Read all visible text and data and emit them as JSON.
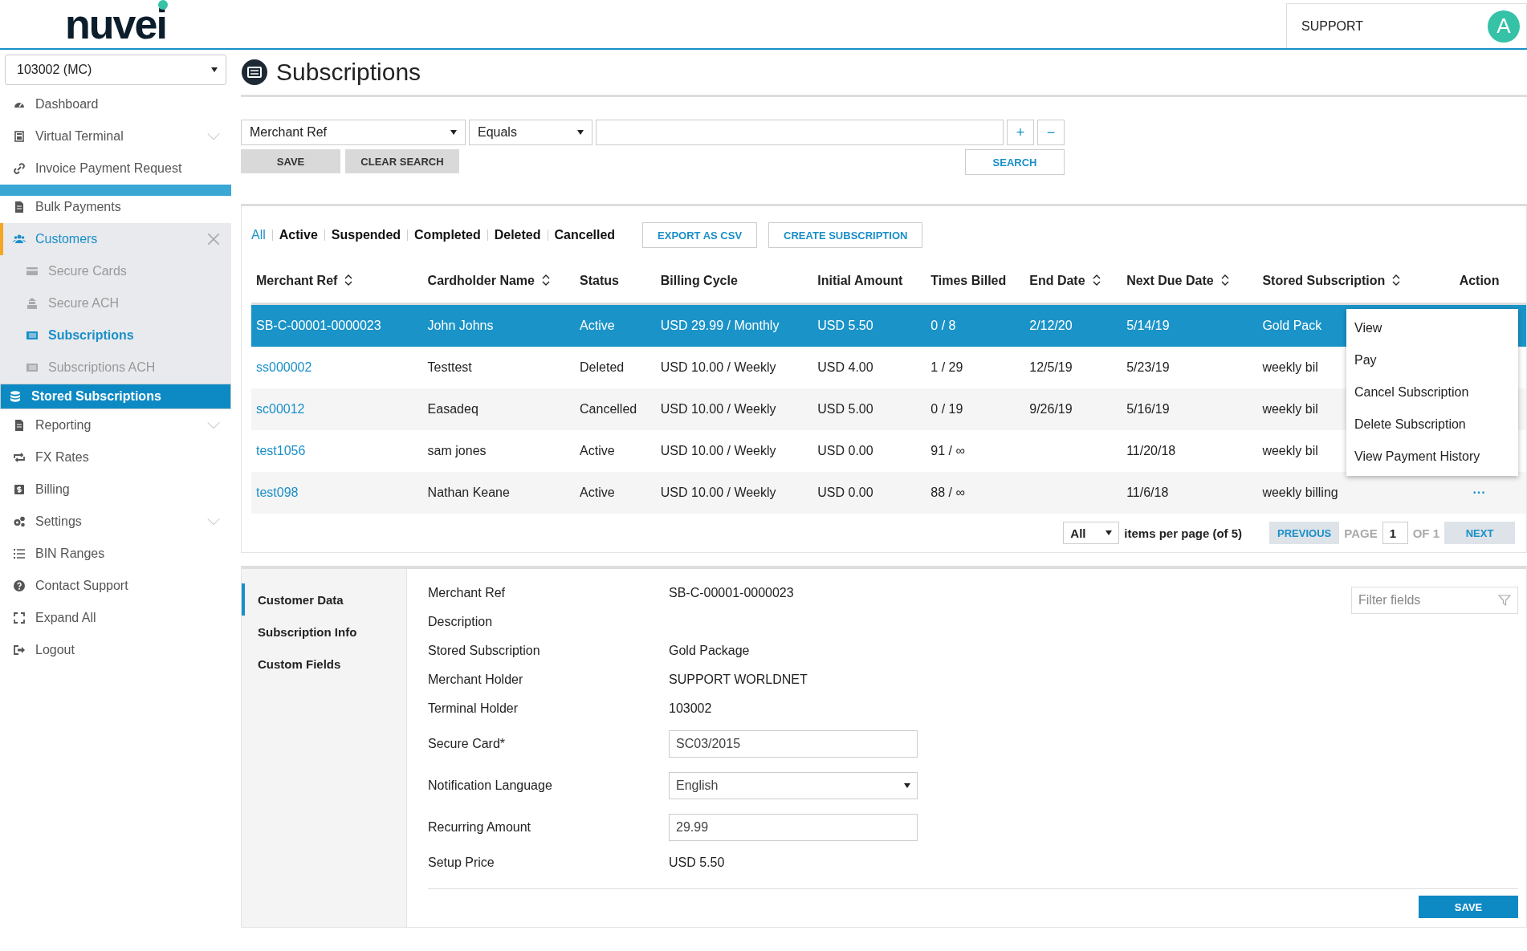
{
  "header": {
    "logo": "nuvei",
    "support": "SUPPORT",
    "avatar": "A"
  },
  "sidebar": {
    "account": "103002 (MC)",
    "items": [
      {
        "label": "Dashboard",
        "expandable": false
      },
      {
        "label": "Virtual Terminal",
        "expandable": true
      },
      {
        "label": "Invoice Payment Request",
        "expandable": false
      },
      {
        "label": "Bulk Payments",
        "expandable": false
      },
      {
        "label": "Customers",
        "expanded": true,
        "children": [
          {
            "label": "Secure Cards",
            "selected": false,
            "disabled": true
          },
          {
            "label": "Secure ACH",
            "selected": false,
            "disabled": true
          },
          {
            "label": "Subscriptions",
            "selected": false,
            "disabled": false
          },
          {
            "label": "Subscriptions ACH",
            "selected": false,
            "disabled": true
          },
          {
            "label": "Stored Subscriptions",
            "selected": true,
            "disabled": false
          }
        ]
      },
      {
        "label": "Reporting",
        "expandable": true
      },
      {
        "label": "FX Rates",
        "expandable": false
      },
      {
        "label": "Billing",
        "expandable": false
      },
      {
        "label": "Settings",
        "expandable": true
      },
      {
        "label": "BIN Ranges",
        "expandable": false
      },
      {
        "label": "Contact Support",
        "expandable": false
      },
      {
        "label": "Expand All",
        "expandable": false
      },
      {
        "label": "Logout",
        "expandable": false
      }
    ]
  },
  "page": {
    "title": "Subscriptions"
  },
  "search": {
    "field": "Merchant Ref",
    "operator": "Equals",
    "add": "+",
    "remove": "−",
    "save": "SAVE",
    "clear": "CLEAR SEARCH",
    "search": "SEARCH"
  },
  "status_filters": [
    {
      "label": "All",
      "selected": true
    },
    {
      "label": "Active",
      "selected": false
    },
    {
      "label": "Suspended",
      "selected": false
    },
    {
      "label": "Completed",
      "selected": false
    },
    {
      "label": "Deleted",
      "selected": false
    },
    {
      "label": "Cancelled",
      "selected": false
    }
  ],
  "actions": [
    "EXPORT AS CSV",
    "CREATE SUBSCRIPTION"
  ],
  "table": {
    "columns": [
      {
        "label": "Merchant Ref",
        "sortable": true
      },
      {
        "label": "Cardholder Name",
        "sortable": true
      },
      {
        "label": "Status",
        "sortable": false
      },
      {
        "label": "Billing Cycle",
        "sortable": false
      },
      {
        "label": "Initial Amount",
        "sortable": false
      },
      {
        "label": "Times Billed",
        "sortable": false
      },
      {
        "label": "End Date",
        "sortable": true
      },
      {
        "label": "Next Due Date",
        "sortable": true
      },
      {
        "label": "Stored Subscription",
        "sortable": true
      },
      {
        "label": "Action",
        "sortable": false
      }
    ],
    "rows": [
      {
        "selected": true,
        "cells": [
          "SB-C-00001-0000023",
          "John Johns",
          "Active",
          "USD 29.99 / Monthly",
          "USD 5.50",
          "0 / 8",
          "2/12/20",
          "5/14/19",
          "Gold Pack"
        ]
      },
      {
        "selected": false,
        "cells": [
          "ss000002",
          "Testtest",
          "Deleted",
          "USD 10.00 / Weekly",
          "USD 4.00",
          "1 / 29",
          "12/5/19",
          "5/23/19",
          "weekly bil"
        ]
      },
      {
        "selected": false,
        "cells": [
          "sc00012",
          "Easadeq",
          "Cancelled",
          "USD 10.00 / Weekly",
          "USD 5.00",
          "0 / 19",
          "9/26/19",
          "5/16/19",
          "weekly bil"
        ]
      },
      {
        "selected": false,
        "cells": [
          "test1056",
          "sam jones",
          "Active",
          "USD 10.00 / Weekly",
          "USD 0.00",
          "91 / ∞",
          "",
          "11/20/18",
          "weekly bil"
        ]
      },
      {
        "selected": false,
        "cells": [
          "test098",
          "Nathan Keane",
          "Active",
          "USD 10.00 / Weekly",
          "USD 0.00",
          "88 / ∞",
          "",
          "11/6/18",
          "weekly billing"
        ],
        "action": "···"
      }
    ]
  },
  "action_menu": [
    "View",
    "Pay",
    "Cancel Subscription",
    "Delete Subscription",
    "View Payment History"
  ],
  "pagination": {
    "per_page": "All",
    "per_page_label": "items per page (of 5)",
    "previous": "PREVIOUS",
    "page_label": "PAGE",
    "page": "1",
    "of": "OF 1",
    "next": "NEXT"
  },
  "details": {
    "tabs": [
      {
        "label": "Customer Data",
        "selected": true
      },
      {
        "label": "Subscription Info",
        "selected": false
      },
      {
        "label": "Custom Fields",
        "selected": false
      }
    ],
    "filter_placeholder": "Filter fields",
    "fields": [
      {
        "kind": "text",
        "label": "Merchant Ref",
        "value": "SB-C-00001-0000023"
      },
      {
        "kind": "text",
        "label": "Description"
      },
      {
        "kind": "text",
        "label": "Stored Subscription",
        "value": "Gold Package"
      },
      {
        "kind": "text",
        "label": "Merchant Holder",
        "value": "SUPPORT WORLDNET"
      },
      {
        "kind": "text",
        "label": "Terminal Holder",
        "value": "103002"
      },
      {
        "kind": "input",
        "label": "Secure Card*",
        "value": "SC03/2015"
      },
      {
        "kind": "select",
        "label": "Notification Language",
        "value": "English"
      },
      {
        "kind": "input",
        "label": "Recurring Amount",
        "value": "29.99"
      },
      {
        "kind": "text",
        "label": "Setup Price",
        "value": "USD 5.50"
      }
    ],
    "save": "SAVE"
  }
}
